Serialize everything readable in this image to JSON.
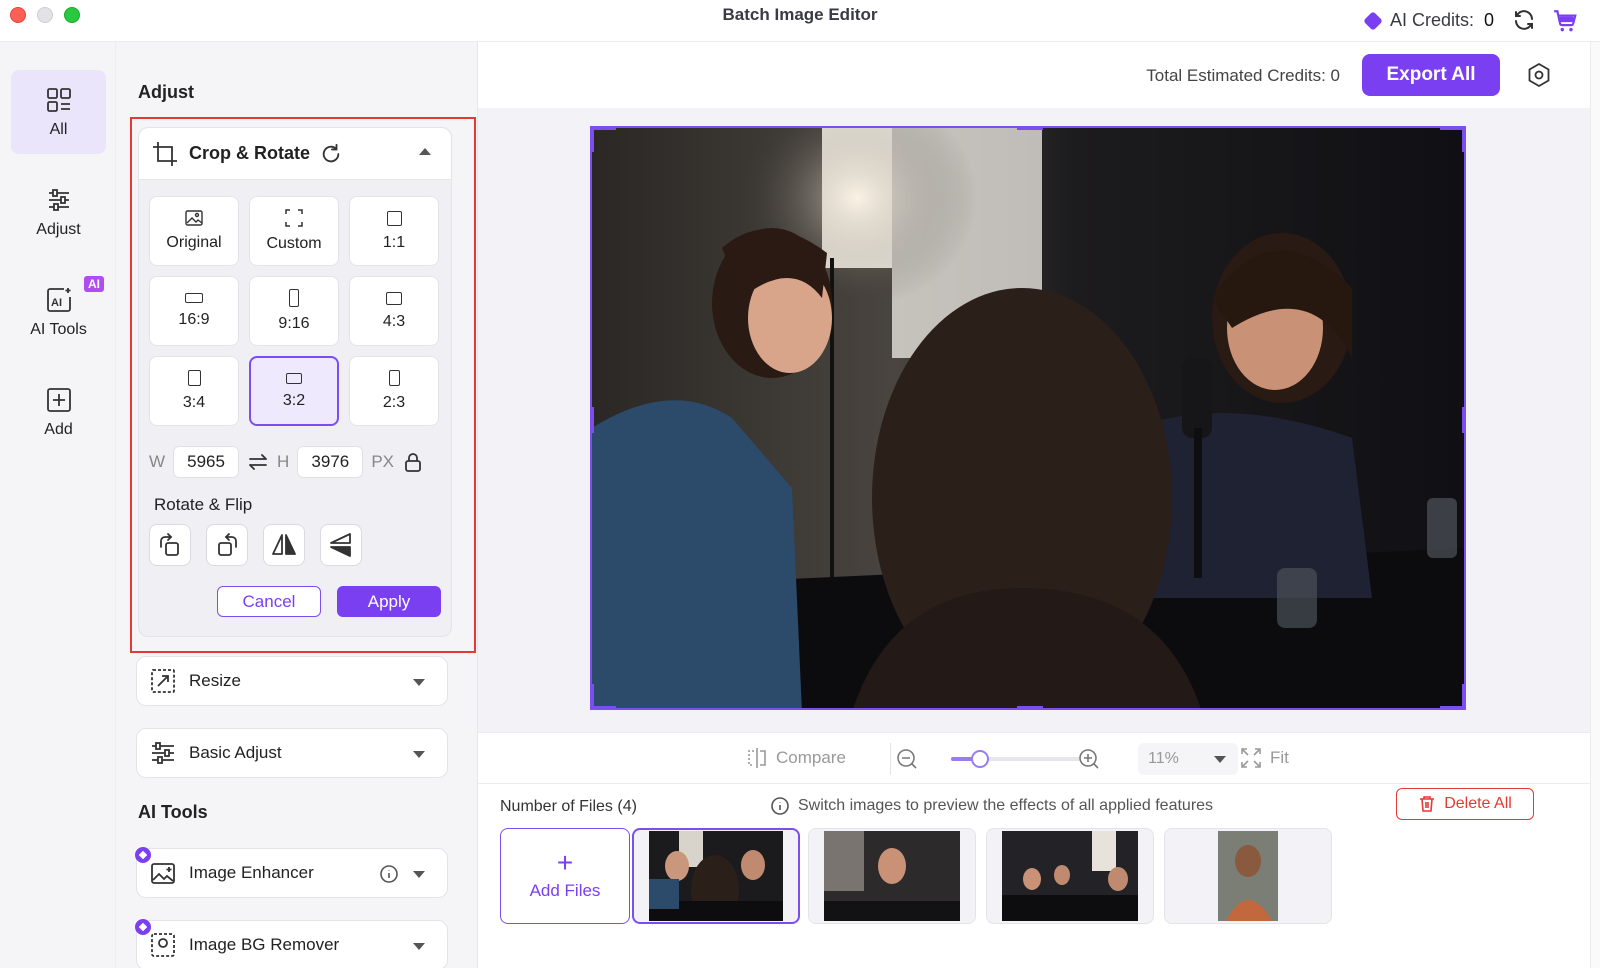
{
  "window": {
    "title": "Batch Image Editor"
  },
  "credits": {
    "label": "AI Credits:",
    "value": "0"
  },
  "rail": {
    "items": [
      {
        "label": "All",
        "icon": "grid-icon",
        "active": true
      },
      {
        "label": "Adjust",
        "icon": "sliders-icon",
        "active": false
      },
      {
        "label": "AI Tools",
        "icon": "ai-tools-icon",
        "active": false,
        "badge": "AI"
      },
      {
        "label": "Add",
        "icon": "add-square-icon",
        "active": false
      }
    ]
  },
  "panel": {
    "adjust_title": "Adjust",
    "crop": {
      "title": "Crop & Rotate",
      "ratios": [
        "Original",
        "Custom",
        "1:1",
        "16:9",
        "9:16",
        "4:3",
        "3:4",
        "3:2",
        "2:3"
      ],
      "selected_ratio": "3:2",
      "width_label": "W",
      "width_value": "5965",
      "height_label": "H",
      "height_value": "3976",
      "unit": "PX",
      "rotate_flip_title": "Rotate & Flip",
      "cancel_label": "Cancel",
      "apply_label": "Apply"
    },
    "resize_label": "Resize",
    "basic_adjust_label": "Basic Adjust",
    "ai_tools_title": "AI Tools",
    "image_enhancer_label": "Image Enhancer",
    "bg_remover_label": "Image BG Remover"
  },
  "main": {
    "est_credits": "Total Estimated Credits: 0",
    "export_label": "Export All",
    "compare_label": "Compare",
    "zoom_value": "11%",
    "fit_label": "Fit",
    "zoom_fraction": 0.22,
    "files_label": "Number of Files (4)",
    "files_hint": "Switch images to preview the effects of all applied features",
    "delete_all_label": "Delete All",
    "add_files_label": "Add Files"
  },
  "colors": {
    "accent": "#7b3ff2",
    "danger": "#e53935",
    "panel_bg": "#f5f5f8"
  }
}
